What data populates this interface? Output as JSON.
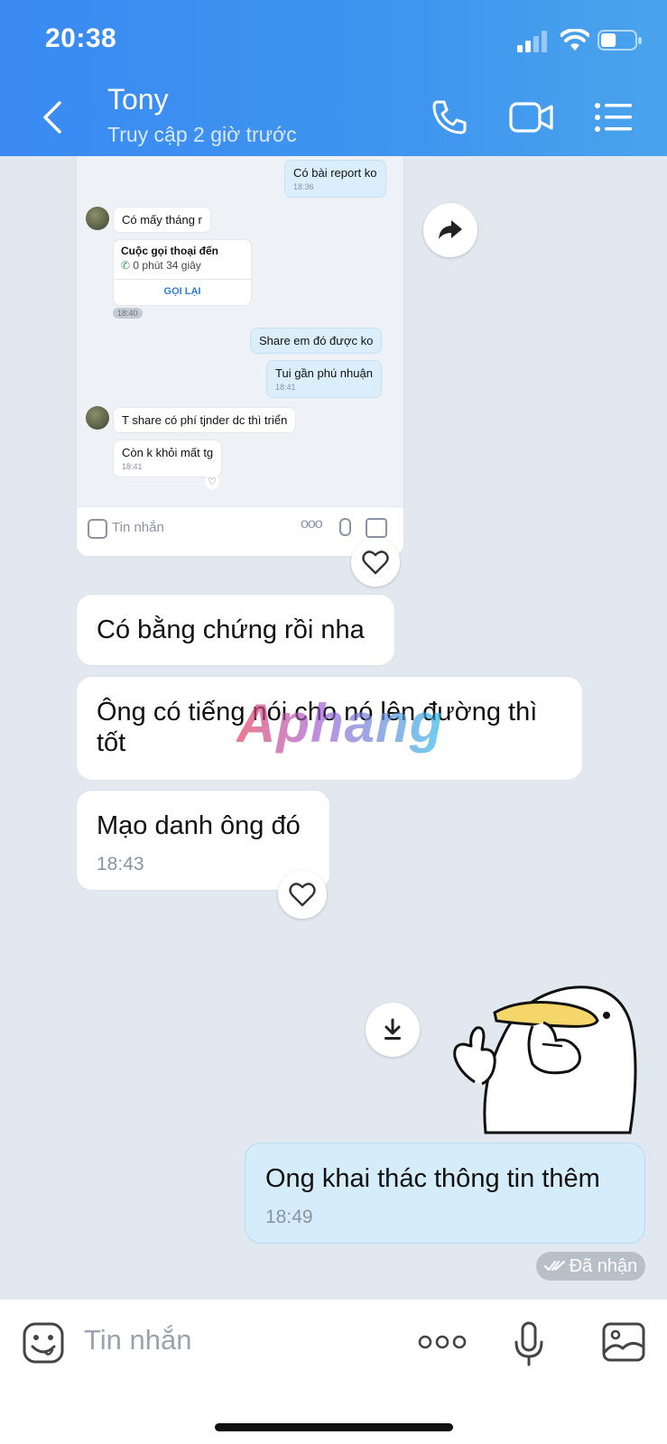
{
  "status_bar": {
    "time": "20:38",
    "battery_level": 0.45
  },
  "header": {
    "contact_name": "Tony",
    "last_seen": "Truy cập 2 giờ trước"
  },
  "shared_screenshot": {
    "messages": [
      {
        "side": "me",
        "text": "Có bài report ko",
        "time": "18:36"
      },
      {
        "side": "them",
        "text": "Có mấy tháng r"
      },
      {
        "side": "them",
        "call_title": "Cuộc gọi thoại đến",
        "call_duration": "0 phút 34 giây",
        "call_action": "GỌI LẠI",
        "time": "18:40"
      },
      {
        "side": "me",
        "text": "Share em đó được ko"
      },
      {
        "side": "me",
        "text": "Tui gần phú nhuận",
        "time": "18:41"
      },
      {
        "side": "them",
        "text": "T share có phí tjnder dc thì triển"
      },
      {
        "side": "them",
        "text": "Còn k khỏi mất tg",
        "time": "18:41"
      }
    ],
    "composer_placeholder": "Tin nhắn"
  },
  "messages": [
    {
      "side": "them",
      "text": "Có bằng chứng rồi nha"
    },
    {
      "side": "them",
      "text": "Ông có tiếng nói cho nó lên đường thì tốt"
    },
    {
      "side": "them",
      "text": "Mạo danh ông đó",
      "time": "18:43"
    },
    {
      "side": "me",
      "text": "Ong khai thác thông tin thêm",
      "time": "18:49"
    }
  ],
  "watermark": "Aphang",
  "receipt": "Đã nhận",
  "composer": {
    "placeholder": "Tin nhắn"
  },
  "colors": {
    "header": "#3f95ef",
    "chat_bg": "#e2e8f0",
    "my_bubble": "#d5ecfb",
    "their_bubble": "#ffffff"
  }
}
